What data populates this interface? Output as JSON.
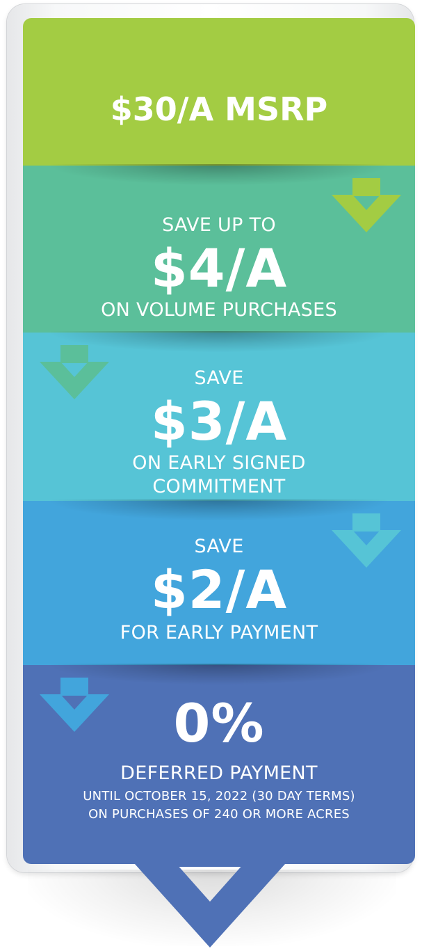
{
  "bands": {
    "msrp": {
      "title": "$30/A MSRP",
      "color": "#a3cc43"
    },
    "volume": {
      "prefix": "SAVE UP TO",
      "amount": "$4/A",
      "suffix": "ON VOLUME PURCHASES",
      "color": "#5bbf9a"
    },
    "early_commitment": {
      "prefix": "SAVE",
      "amount": "$3/A",
      "suffix_line1": "ON EARLY SIGNED",
      "suffix_line2": "COMMITMENT",
      "color": "#56c4d6"
    },
    "early_payment": {
      "prefix": "SAVE",
      "amount": "$2/A",
      "suffix": "FOR EARLY PAYMENT",
      "color": "#42a5dc"
    },
    "deferred": {
      "amount": "0%",
      "label": "DEFERRED PAYMENT",
      "note_line1": "UNTIL OCTOBER 15, 2022 (30 DAY TERMS)",
      "note_line2": "ON PURCHASES OF 240 OR MORE ACRES",
      "color": "#4f71b6"
    }
  },
  "icons": [
    "chevron-down-icon"
  ]
}
